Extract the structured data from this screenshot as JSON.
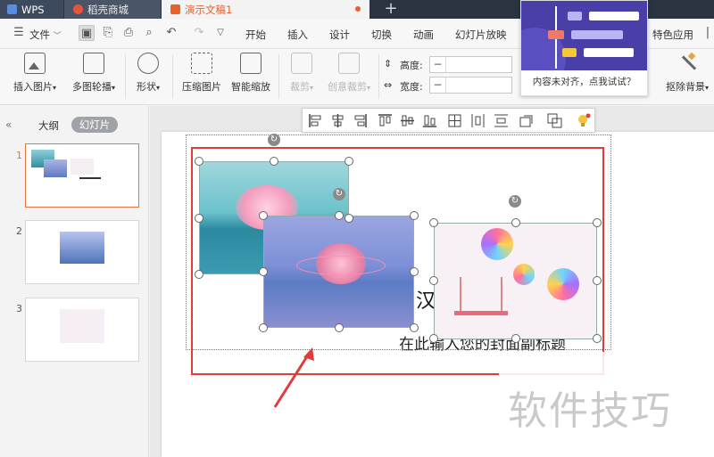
{
  "tabs": {
    "wps": "WPS",
    "store": "稻壳商城",
    "doc": "演示文稿1",
    "add": "+"
  },
  "menu": {
    "file": "文件",
    "items": [
      "开始",
      "插入",
      "设计",
      "切换",
      "动画",
      "幻灯片放映"
    ],
    "special": "特色应用"
  },
  "ribbon": {
    "insert_picture": "插入图片",
    "multi_carousel": "多图轮播",
    "shape": "形状",
    "compress_picture": "压缩图片",
    "smart_zoom": "智能缩放",
    "crop": "裁剪",
    "creative_crop": "创意裁剪",
    "height_label": "高度:",
    "width_label": "宽度:",
    "minus": "−",
    "remove_bg": "抠除背景"
  },
  "popup": {
    "text": "内容未对齐，点我试试？"
  },
  "left_panel": {
    "outline_tab": "大纲",
    "slides_tab": "幻灯片",
    "collapse": "«",
    "slide_numbers": [
      "1",
      "2",
      "3"
    ]
  },
  "slide": {
    "subtitle": "在此输入您的封面副标题",
    "title_fragment": "汉"
  },
  "watermark": "软件技巧",
  "colors": {
    "accent_orange": "#e8612c",
    "selection_red": "#e03c3c",
    "tabbar_dark": "#2b3340"
  }
}
